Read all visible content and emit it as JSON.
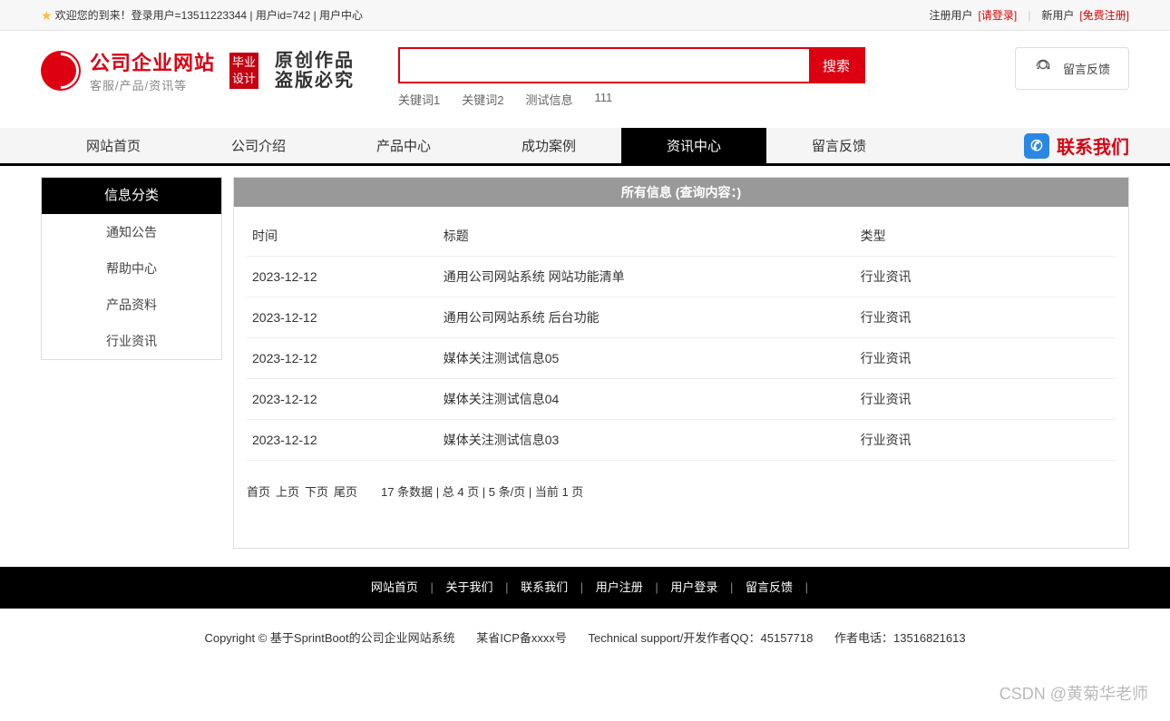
{
  "topbar": {
    "welcome": "欢迎您的到来！登录用户=13511223344 | 用户id=742 | 用户中心",
    "registerUserLabel": "注册用户",
    "loginLink": "[请登录]",
    "newUserLabel": "新用户",
    "freeRegister": "[免费注册]"
  },
  "logo": {
    "main": "公司企业网站",
    "sub": "客服/产品/资讯等",
    "badge1": "毕业",
    "badge2": "设计",
    "script1": "原创作品",
    "script2": "盗版必究"
  },
  "search": {
    "button": "搜索",
    "keywords": [
      "关键词1",
      "关键词2",
      "测试信息",
      "111"
    ]
  },
  "feedbackBtn": "留言反馈",
  "nav": {
    "items": [
      "网站首页",
      "公司介绍",
      "产品中心",
      "成功案例",
      "资讯中心",
      "留言反馈"
    ],
    "activeIndex": 4,
    "contact": "联系我们"
  },
  "sidebar": {
    "header": "信息分类",
    "items": [
      "通知公告",
      "帮助中心",
      "产品资料",
      "行业资讯"
    ]
  },
  "content": {
    "header": "所有信息 (查询内容：)",
    "columns": {
      "time": "时间",
      "title": "标题",
      "type": "类型"
    },
    "rows": [
      {
        "time": "2023-12-12",
        "title": "通用公司网站系统 网站功能清单",
        "type": "行业资讯"
      },
      {
        "time": "2023-12-12",
        "title": "通用公司网站系统 后台功能",
        "type": "行业资讯"
      },
      {
        "time": "2023-12-12",
        "title": "媒体关注测试信息05",
        "type": "行业资讯"
      },
      {
        "time": "2023-12-12",
        "title": "媒体关注测试信息04",
        "type": "行业资讯"
      },
      {
        "time": "2023-12-12",
        "title": "媒体关注测试信息03",
        "type": "行业资讯"
      }
    ]
  },
  "pagination": {
    "first": "首页",
    "prev": "上页",
    "next": "下页",
    "last": "尾页",
    "info": "17 条数据 | 总 4 页 | 5 条/页 | 当前 1 页"
  },
  "footerNav": [
    "网站首页",
    "关于我们",
    "联系我们",
    "用户注册",
    "用户登录",
    "留言反馈"
  ],
  "footerInfo": {
    "copyright": "Copyright © 基于SprintBoot的公司企业网站系统",
    "icp": "某省ICP备xxxx号",
    "tech": "Technical support/开发作者QQ：45157718",
    "phone": "作者电话：13516821613"
  },
  "watermark": "CSDN @黄菊华老师"
}
